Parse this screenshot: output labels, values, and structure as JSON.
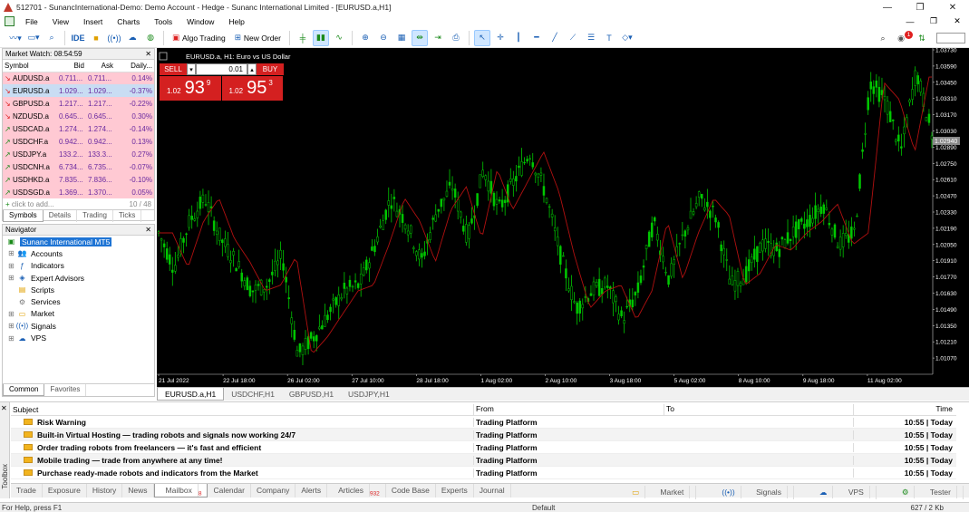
{
  "window": {
    "title": "512701 - SunancInternational-Demo: Demo Account - Hedge - Sunanc International Limited - [EURUSD.a,H1]"
  },
  "menu": [
    "File",
    "View",
    "Insert",
    "Charts",
    "Tools",
    "Window",
    "Help"
  ],
  "toolbar": {
    "ide": "IDE",
    "algo": "Algo Trading",
    "new_order": "New Order",
    "notif_count": "1"
  },
  "market_watch": {
    "title": "Market Watch: 08:54:59",
    "cols": [
      "Symbol",
      "Bid",
      "Ask",
      "Daily..."
    ],
    "rows": [
      {
        "sym": "AUDUSD.a",
        "bid": "0.711...",
        "ask": "0.711...",
        "chg": "0.14%",
        "dir": "dn"
      },
      {
        "sym": "EURUSD.a",
        "bid": "1.029...",
        "ask": "1.029...",
        "chg": "-0.37%",
        "dir": "dn",
        "selected": true
      },
      {
        "sym": "GBPUSD.a",
        "bid": "1.217...",
        "ask": "1.217...",
        "chg": "-0.22%",
        "dir": "dn"
      },
      {
        "sym": "NZDUSD.a",
        "bid": "0.645...",
        "ask": "0.645...",
        "chg": "0.30%",
        "dir": "dn"
      },
      {
        "sym": "USDCAD.a",
        "bid": "1.274...",
        "ask": "1.274...",
        "chg": "-0.14%",
        "dir": "up"
      },
      {
        "sym": "USDCHF.a",
        "bid": "0.942...",
        "ask": "0.942...",
        "chg": "0.13%",
        "dir": "up"
      },
      {
        "sym": "USDJPY.a",
        "bid": "133.2...",
        "ask": "133.3...",
        "chg": "0.27%",
        "dir": "up"
      },
      {
        "sym": "USDCNH.a",
        "bid": "6.734...",
        "ask": "6.735...",
        "chg": "-0.07%",
        "dir": "up"
      },
      {
        "sym": "USDHKD.a",
        "bid": "7.835...",
        "ask": "7.836...",
        "chg": "-0.10%",
        "dir": "up"
      },
      {
        "sym": "USDSGD.a",
        "bid": "1.369...",
        "ask": "1.370...",
        "chg": "0.05%",
        "dir": "up"
      }
    ],
    "add_placeholder": "click to add...",
    "count": "10 / 48",
    "tabs": [
      "Symbols",
      "Details",
      "Trading",
      "Ticks"
    ]
  },
  "navigator": {
    "title": "Navigator",
    "root": "Sunanc International MT5",
    "items": [
      "Accounts",
      "Indicators",
      "Expert Advisors",
      "Scripts",
      "Services",
      "Market",
      "Signals",
      "VPS"
    ],
    "tabs": [
      "Common",
      "Favorites"
    ]
  },
  "chart": {
    "header": "EURUSD.a, H1:  Euro vs US Dollar",
    "sell_label": "SELL",
    "buy_label": "BUY",
    "lot": "0.01",
    "sell_small": "1.02",
    "sell_big": "93",
    "sell_tiny": "9",
    "buy_small": "1.02",
    "buy_big": "95",
    "buy_tiny": "3",
    "current_price": "1.02940",
    "tabs": [
      "EURUSD.a,H1",
      "USDCHF,H1",
      "GBPUSD,H1",
      "USDJPY,H1"
    ]
  },
  "chart_data": {
    "type": "line",
    "title": "EURUSD.a, H1",
    "x_ticks": [
      "21 Jul 2022",
      "22 Jul 18:00",
      "26 Jul 02:00",
      "27 Jul 10:00",
      "28 Jul 18:00",
      "1 Aug 02:00",
      "2 Aug 10:00",
      "3 Aug 18:00",
      "5 Aug 02:00",
      "8 Aug 10:00",
      "9 Aug 18:00",
      "11 Aug 02:00"
    ],
    "y_ticks": [
      "1.03730",
      "1.03590",
      "1.03450",
      "1.03310",
      "1.03170",
      "1.03030",
      "1.02890",
      "1.02750",
      "1.02610",
      "1.02470",
      "1.02330",
      "1.02190",
      "1.02050",
      "1.01910",
      "1.01770",
      "1.01630",
      "1.01490",
      "1.01350",
      "1.01210",
      "1.01070"
    ],
    "ylim": [
      1.0093,
      1.0373
    ],
    "series": [
      {
        "color": "#00c800",
        "x": [
          0,
          0.02,
          0.04,
          0.06,
          0.08,
          0.1,
          0.12,
          0.14,
          0.16,
          0.18,
          0.2,
          0.22,
          0.24,
          0.26,
          0.28,
          0.3,
          0.32,
          0.34,
          0.36,
          0.38,
          0.4,
          0.42,
          0.44,
          0.46,
          0.48,
          0.5,
          0.52,
          0.54,
          0.56,
          0.58,
          0.6,
          0.62,
          0.64,
          0.66,
          0.68,
          0.7,
          0.72,
          0.74,
          0.76,
          0.78,
          0.8,
          0.82,
          0.84,
          0.86,
          0.88,
          0.9,
          0.92,
          0.94,
          0.96,
          0.98,
          1.0
        ],
        "values": [
          1.0215,
          1.0185,
          1.0225,
          1.0245,
          1.021,
          1.019,
          1.0165,
          1.017,
          1.0195,
          1.011,
          1.0125,
          1.0145,
          1.0165,
          1.017,
          1.0205,
          1.0245,
          1.0225,
          1.019,
          1.0235,
          1.0255,
          1.021,
          1.027,
          1.0235,
          1.026,
          1.0285,
          1.025,
          1.0195,
          1.015,
          1.0165,
          1.017,
          1.014,
          1.0165,
          1.0225,
          1.0175,
          1.0215,
          1.0245,
          1.023,
          1.017,
          1.018,
          1.0205,
          1.02,
          1.0215,
          1.0225,
          1.024,
          1.0205,
          1.0215,
          1.0345,
          1.033,
          1.0285,
          1.0355,
          1.03
        ]
      }
    ]
  },
  "toolbox": {
    "label": "Toolbox",
    "cols": [
      "Subject",
      "From",
      "To",
      "Time"
    ],
    "rows": [
      {
        "subject": "Risk Warning",
        "from": "Trading Platform",
        "time": "10:55 | Today"
      },
      {
        "subject": "Built-in Virtual Hosting — trading robots and signals now working 24/7",
        "from": "Trading Platform",
        "time": "10:55 | Today"
      },
      {
        "subject": "Order trading robots from freelancers — it's fast and efficient",
        "from": "Trading Platform",
        "time": "10:55 | Today"
      },
      {
        "subject": "Mobile trading — trade from anywhere at any time!",
        "from": "Trading Platform",
        "time": "10:55 | Today"
      },
      {
        "subject": "Purchase ready-made robots and indicators from the Market",
        "from": "Trading Platform",
        "time": "10:55 | Today"
      }
    ],
    "tabs": [
      "Trade",
      "Exposure",
      "History",
      "News",
      "Mailbox",
      "Calendar",
      "Company",
      "Alerts",
      "Articles",
      "Code Base",
      "Experts",
      "Journal"
    ],
    "mailbox_count": "8",
    "articles_count": "932",
    "right": [
      "Market",
      "Signals",
      "VPS",
      "Tester"
    ]
  },
  "status": {
    "left": "For Help, press F1",
    "mid": "Default",
    "right": "627 / 2 Kb"
  }
}
